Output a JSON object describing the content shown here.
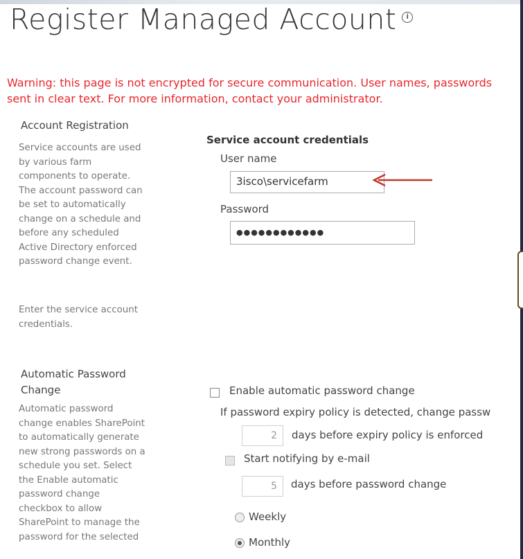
{
  "page": {
    "title": "Register Managed Account",
    "info_icon_glyph": "i",
    "warning_line1": "Warning: this page is not encrypted for secure communication. User names, passwords",
    "warning_line2": "sent in clear text. For more information, contact your administrator."
  },
  "account_registration": {
    "heading": "Account Registration",
    "desc_lines": [
      "Service accounts are used",
      "by various farm",
      "components to operate.",
      "The account password can",
      "be set to automatically",
      "change on a schedule and",
      "before any scheduled",
      "Active Directory enforced",
      "password change event."
    ],
    "enter_lines": [
      "Enter the service account",
      "credentials."
    ],
    "credentials_heading": "Service account credentials",
    "username_label": "User name",
    "username_value": "3isco\\servicefarm",
    "password_label": "Password",
    "password_value": "●●●●●●●●●●●●"
  },
  "auto_password": {
    "heading_line1": "Automatic Password",
    "heading_line2": "Change",
    "desc_lines": [
      "Automatic password",
      "change enables SharePoint",
      "to automatically generate",
      "new strong passwords on a",
      "schedule you set. Select",
      "the Enable automatic",
      "password change",
      "checkbox to allow",
      "SharePoint to manage the",
      "password for the selected"
    ],
    "enable_label": "Enable automatic password change",
    "enable_checked": false,
    "expiry_text": "If password expiry policy is detected, change passw",
    "days_before_expiry_value": "2",
    "days_before_expiry_label": "days before expiry policy is enforced",
    "notify_label": "Start notifying by e-mail",
    "notify_days_value": "5",
    "notify_days_label": "days before password change",
    "weekly_label": "Weekly",
    "monthly_label": "Monthly",
    "selected_schedule": "Monthly"
  },
  "colors": {
    "warning": "#e8262b",
    "arrow": "#c0392b",
    "title": "#333333"
  }
}
